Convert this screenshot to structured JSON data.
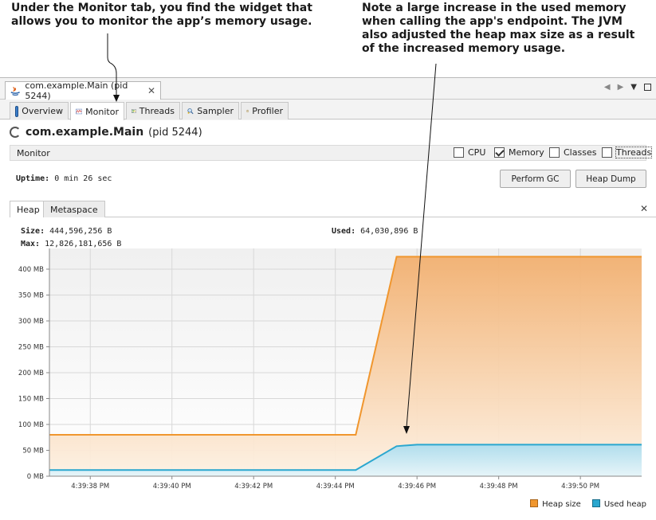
{
  "annotations": {
    "left": [
      "Under the Monitor tab, you find the widget that",
      "allows you to monitor the app’s memory usage."
    ],
    "right": [
      "Note a large increase in the used memory",
      "when calling the app's endpoint. The JVM",
      "also adjusted the heap max size as a result",
      "of the increased memory usage."
    ]
  },
  "window": {
    "doc_tab_label": "com.example.Main (pid 5244)",
    "view_tabs": [
      {
        "label": "Overview",
        "icon": "overview-icon"
      },
      {
        "label": "Monitor",
        "icon": "monitor-icon"
      },
      {
        "label": "Threads",
        "icon": "threads-icon"
      },
      {
        "label": "Sampler",
        "icon": "sampler-icon"
      },
      {
        "label": "Profiler",
        "icon": "profiler-icon"
      }
    ],
    "active_view_tab": "Monitor"
  },
  "process": {
    "name": "com.example.Main",
    "pid_text": "(pid 5244)"
  },
  "monitor": {
    "label": "Monitor",
    "checkboxes": [
      {
        "label": "CPU",
        "checked": false
      },
      {
        "label": "Memory",
        "checked": true
      },
      {
        "label": "Classes",
        "checked": false
      },
      {
        "label": "Threads",
        "checked": false
      }
    ],
    "uptime_label": "Uptime:",
    "uptime_value": "0 min 26 sec",
    "perform_gc": "Perform GC",
    "heap_dump": "Heap Dump"
  },
  "heap_panel": {
    "tabs": [
      "Heap",
      "Metaspace"
    ],
    "size_label": "Size:",
    "size_value": "444,596,256 B",
    "max_label": "Max:",
    "max_value": "12,826,181,656 B",
    "used_label": "Used:",
    "used_value": "64,030,896 B"
  },
  "chart_data": {
    "type": "area",
    "x": [
      "4:39:37",
      "4:39:38",
      "4:39:40",
      "4:39:42",
      "4:39:44",
      "4:39:44.5",
      "4:39:45.5",
      "4:39:46",
      "4:39:48",
      "4:39:50",
      "4:39:51.5"
    ],
    "x_tick_labels": [
      "4:39:38 PM",
      "4:39:40 PM",
      "4:39:42 PM",
      "4:39:44 PM",
      "4:39:46 PM",
      "4:39:48 PM",
      "4:39:50 PM"
    ],
    "y_tick_labels": [
      "0 MB",
      "50 MB",
      "100 MB",
      "150 MB",
      "200 MB",
      "250 MB",
      "300 MB",
      "350 MB",
      "400 MB"
    ],
    "ylim": [
      0,
      440
    ],
    "series": [
      {
        "name": "Heap size",
        "color": "#f0962e",
        "values": [
          80,
          80,
          80,
          80,
          80,
          80,
          424,
          424,
          424,
          424,
          424
        ]
      },
      {
        "name": "Used heap",
        "color": "#2aa7cf",
        "values": [
          12,
          12,
          12,
          12,
          12,
          12,
          58,
          61,
          61,
          61,
          61
        ]
      }
    ],
    "grid": true,
    "legend": "bottom-right"
  }
}
